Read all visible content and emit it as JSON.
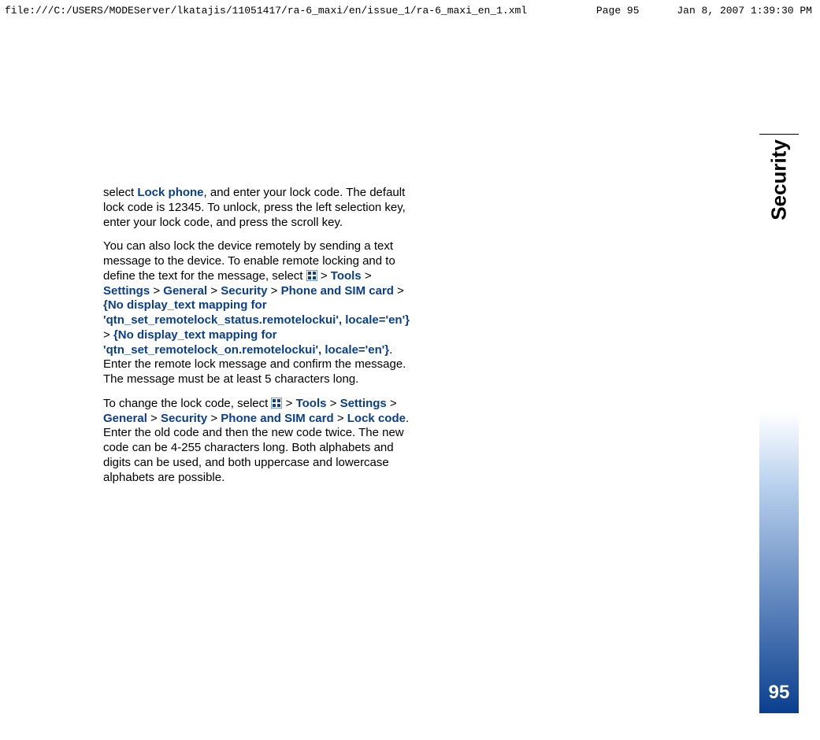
{
  "header": {
    "path": "file:///C:/USERS/MODEServer/lkatajis/11051417/ra-6_maxi/en/issue_1/ra-6_maxi_en_1.xml",
    "page": "Page 95",
    "datetime": "Jan 8, 2007 1:39:30 PM"
  },
  "side": {
    "label": "Security",
    "page_number": "95"
  },
  "para1": {
    "t1": "select ",
    "lock_phone": "Lock phone",
    "t2": ", and enter your lock code. The default lock code is 12345. To unlock, press the left selection key, enter your lock code, and press the scroll key."
  },
  "para2": {
    "t1": "You can also lock the device remotely by sending a text message to the device. To enable remote locking and to define the text for the message, select ",
    "sep": " > ",
    "tools": "Tools",
    "settings": "Settings",
    "general": "General",
    "security": "Security",
    "phone_sim": "Phone and SIM card",
    "no_map_status": "{No display_text mapping for 'qtn_set_remotelock_status.remotelockui', locale='en'}",
    "no_map_on": "{No display_text mapping for 'qtn_set_remotelock_on.remotelockui', locale='en'}",
    "t2": ". Enter the remote lock message and confirm the message. The message must be at least 5 characters long."
  },
  "para3": {
    "t1": "To change the lock code, select ",
    "sep": " > ",
    "tools": "Tools",
    "settings": "Settings",
    "general": "General",
    "security": "Security",
    "phone_sim": "Phone and SIM card",
    "lock_code": "Lock code",
    "t2": ". Enter the old code and then the new code twice. The new code can be 4-255 characters long. Both alphabets and digits can be used, and both uppercase and lowercase alphabets are possible."
  }
}
